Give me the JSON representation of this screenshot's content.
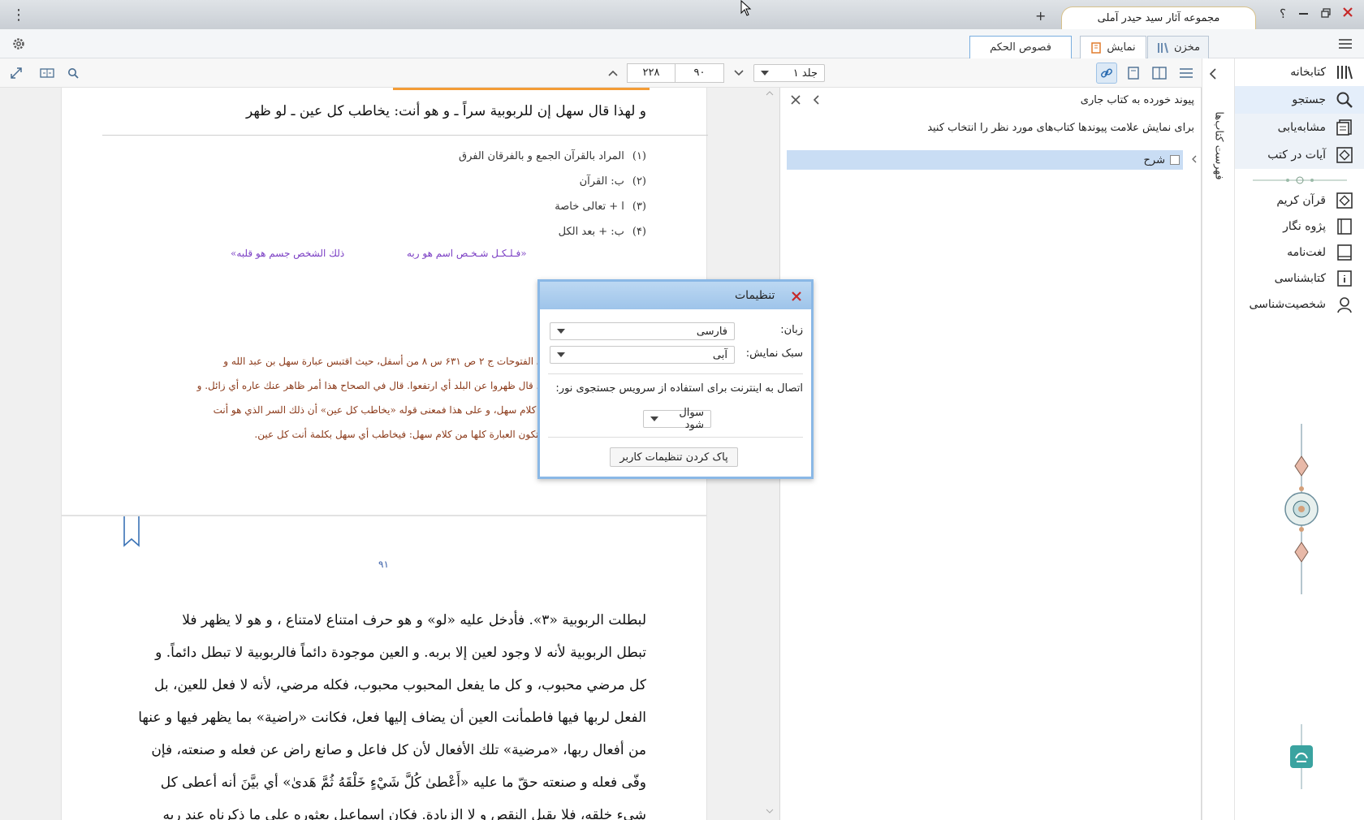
{
  "titlebar": {
    "tab_title": "مجموعه آثار سید حیدر آملی",
    "add_label": "+",
    "help_label": "؟"
  },
  "appbar": {
    "tabs": [
      "مخزن",
      "نمایش"
    ],
    "book_tab": "فصوص الحکم"
  },
  "toolbar": {
    "volume": "جلد ۱",
    "page_current": "۹۰",
    "page_total": "۲۲۸"
  },
  "sidebar": {
    "items": [
      {
        "label": "کتابخانه",
        "icon": "library-icon"
      },
      {
        "label": "جستجو",
        "icon": "search-icon"
      },
      {
        "label": "مشابه‌یابی",
        "icon": "similar-icon"
      },
      {
        "label": "آیات در کتب",
        "icon": "verses-icon"
      },
      {
        "label": "قرآن کریم",
        "icon": "quran-icon"
      },
      {
        "label": "پژوه نگار",
        "icon": "notebook-icon"
      },
      {
        "label": "لغت‌نامه",
        "icon": "dictionary-icon"
      },
      {
        "label": "کتابشناسی",
        "icon": "bibliography-icon"
      },
      {
        "label": "شخصیت‌شناسی",
        "icon": "person-icon"
      }
    ],
    "vertical_tab": "فهرست کتاب‌ها"
  },
  "panel": {
    "title": "پیوند خورده به کتاب جاری",
    "instruction": "برای نمایش علامت پیوندها کتاب‌های مورد نظر را انتخاب کنید",
    "tree_item": "شرح"
  },
  "settings": {
    "title": "تنظیمات",
    "language_label": "زبان:",
    "language_value": "فارسی",
    "style_label": "سبک نمایش:",
    "style_value": "آبی",
    "internet_label": "اتصال به اینترنت برای استفاده از سرویس جستجوی نور:",
    "internet_value": "سوال شود",
    "reset_label": "پاک کردن تنظیمات کاربر"
  },
  "page1": {
    "line": "و لهذا قال سهل إن للربوبية سراً ـ و هو أنت: يخاطب كل عين ـ لو ظهر",
    "footnotes": [
      {
        "num": "(۱)",
        "text": "المراد بالقرآن الجمع و بالفرقان الفرق"
      },
      {
        "num": "(۲)",
        "text": "ب: القرآن"
      },
      {
        "num": "(۳)",
        "text": "ا + تعالى خاصة"
      },
      {
        "num": "(۴)",
        "text": "ب: + بعد الكل"
      }
    ],
    "diagram_right": "«فـلـكـل شـخـص اسم هو ربه",
    "diagram_left": "ذلك الشخص جسم هو قلبه»",
    "commentary": [
      "ذكرها الشيخ في الفتوحات ج ۲ ص ۶۳۱ س ۸ من أسفل، حيث اقتبس عبارة سهل بن عبد الله و",
      "بطلت الربوبية». قال ظهروا عن البلد أي ارتفعوا. قال في الصحاح هذا أمر ظاهر عنك عاره أي زائل. و",
      "ابن عربي لا من كلام سهل، و على هذا فمعنى قوله «يخاطب كل عين» أن ذلك السر الذي هو أنت",
      "جود. و يصح أن تكون العبارة كلها من كلام سهل: فيخاطب أي سهل بكلمة أنت كل عين."
    ]
  },
  "page2": {
    "page_number": "۹۱",
    "lines": [
      "لبطلت الربوبية «۳». فأدخل عليه «لو» و هو حرف امتناع لامتناع ، و هو لا يظهر فلا",
      "تبطل الربوبية لأنه لا وجود لعين إلا بربه. و العين موجودة دائماً فالربوبية لا تبطل دائماً. و",
      "كل مرضي محبوب، و كل ما يفعل المحبوب محبوب، فكله مرضي، لأنه لا فعل للعين، بل",
      "الفعل لربها فيها فاطمأنت العين أن يضاف إليها فعل، فكانت «راضية» بما يظهر فيها و عنها",
      "من أفعال ربها، «مرضية» تلك الأفعال لأن كل فاعل و صانع راض عن فعله و صنعته، فإن",
      "وفّى فعله و صنعته حقّ ما عليه «أَعْطىٰ كُلَّ شَيْءٍ خَلْقَهُ ثُمَّ هَدىٰ» أي بيَّنَ أنه أعطى كل",
      "شيء خلقه، فلا يقبل النقص و لا الزيادة. فكان إسماعيل بعثوره على ما ذكرناه عند ربه"
    ]
  },
  "colors": {
    "accent": "#2a7fd4",
    "footnote_red": "#c0392b",
    "commentary": "#8b3a1a",
    "diagram_purple": "#7b3fc4",
    "quran_green": "#2e8b3a"
  }
}
